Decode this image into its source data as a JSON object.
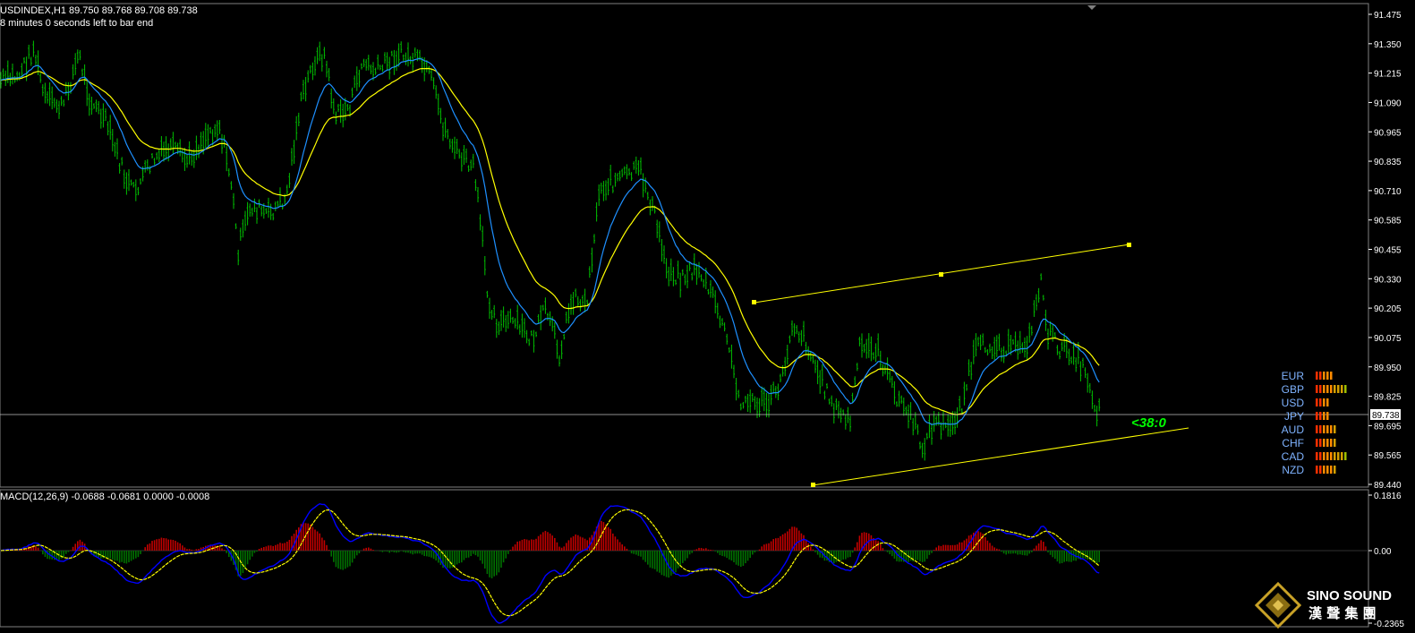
{
  "header": {
    "title": "USDINDEX,H1  89.750 89.768 89.708 89.738",
    "timer": "8 minutes 0 seconds left to bar end"
  },
  "price_axis": {
    "ticks": [
      "91.475",
      "91.350",
      "91.215",
      "91.090",
      "90.965",
      "90.835",
      "90.710",
      "90.585",
      "90.455",
      "90.330",
      "90.205",
      "90.075",
      "89.950",
      "89.825",
      "89.695",
      "89.565",
      "89.440"
    ],
    "current": "89.738"
  },
  "macd": {
    "title": "MACD(12,26,9) -0.0688 -0.0681 0.0000 -0.0008",
    "ticks": [
      "0.1816",
      "0.00",
      "-0.2365"
    ]
  },
  "countdown": "<38:0",
  "currency_strength": [
    {
      "name": "EUR",
      "bars": 5
    },
    {
      "name": "GBP",
      "bars": 9
    },
    {
      "name": "USD",
      "bars": 4
    },
    {
      "name": "JPY",
      "bars": 4
    },
    {
      "name": "AUD",
      "bars": 6
    },
    {
      "name": "CHF",
      "bars": 6
    },
    {
      "name": "CAD",
      "bars": 9
    },
    {
      "name": "NZD",
      "bars": 6
    }
  ],
  "logo": {
    "name": "SINO SOUND",
    "chinese": "漢 聲 集 團"
  },
  "colors": {
    "bull": "#00c000",
    "ma_slow": "#ffff00",
    "ma_fast": "#1e90ff",
    "hist_up": "#c00000",
    "hist_down": "#007000",
    "macd": "#0000ff",
    "signal": "#ffff00"
  }
}
